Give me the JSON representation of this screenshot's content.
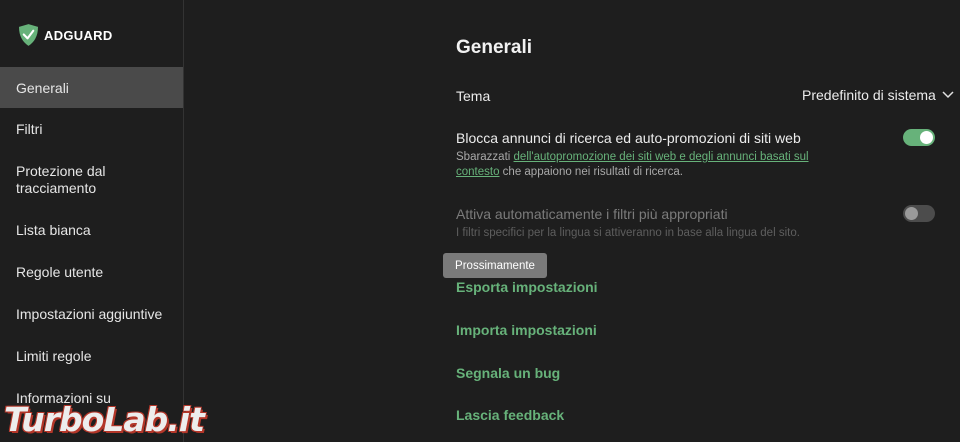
{
  "app": {
    "brand": "ADGUARD",
    "accent_color": "#67b27a"
  },
  "sidebar": {
    "items": [
      {
        "label": "Generali",
        "active": true
      },
      {
        "label": "Filtri",
        "active": false
      },
      {
        "label": "Protezione dal tracciamento",
        "active": false
      },
      {
        "label": "Lista bianca",
        "active": false
      },
      {
        "label": "Regole utente",
        "active": false
      },
      {
        "label": "Impostazioni aggiuntive",
        "active": false
      },
      {
        "label": "Limiti regole",
        "active": false
      },
      {
        "label": "Informazioni su",
        "active": false
      }
    ]
  },
  "main": {
    "title": "Generali",
    "tema": {
      "label": "Tema",
      "value": "Predefinito di sistema",
      "icon": "chevron-down-icon"
    },
    "search_ads": {
      "label": "Blocca annunci di ricerca ed auto-promozioni di siti web",
      "desc_prefix": "Sbarazzati ",
      "desc_link": "dell'autopromozione dei siti web e degli annunci basati sul contesto",
      "desc_suffix": " che appaiono nei risultati di ricerca.",
      "enabled": true
    },
    "auto_filters": {
      "label": "Attiva automaticamente i filtri più appropriati",
      "desc": "I filtri specifici per la lingua si attiveranno in base alla lingua del sito.",
      "enabled": false,
      "disabled": true
    },
    "tooltip": "Prossimamente",
    "actions": [
      {
        "label": "Esporta impostazioni"
      },
      {
        "label": "Importa impostazioni"
      },
      {
        "label": "Segnala un bug"
      },
      {
        "label": "Lascia feedback"
      }
    ]
  },
  "watermark": "TurboLab.it"
}
